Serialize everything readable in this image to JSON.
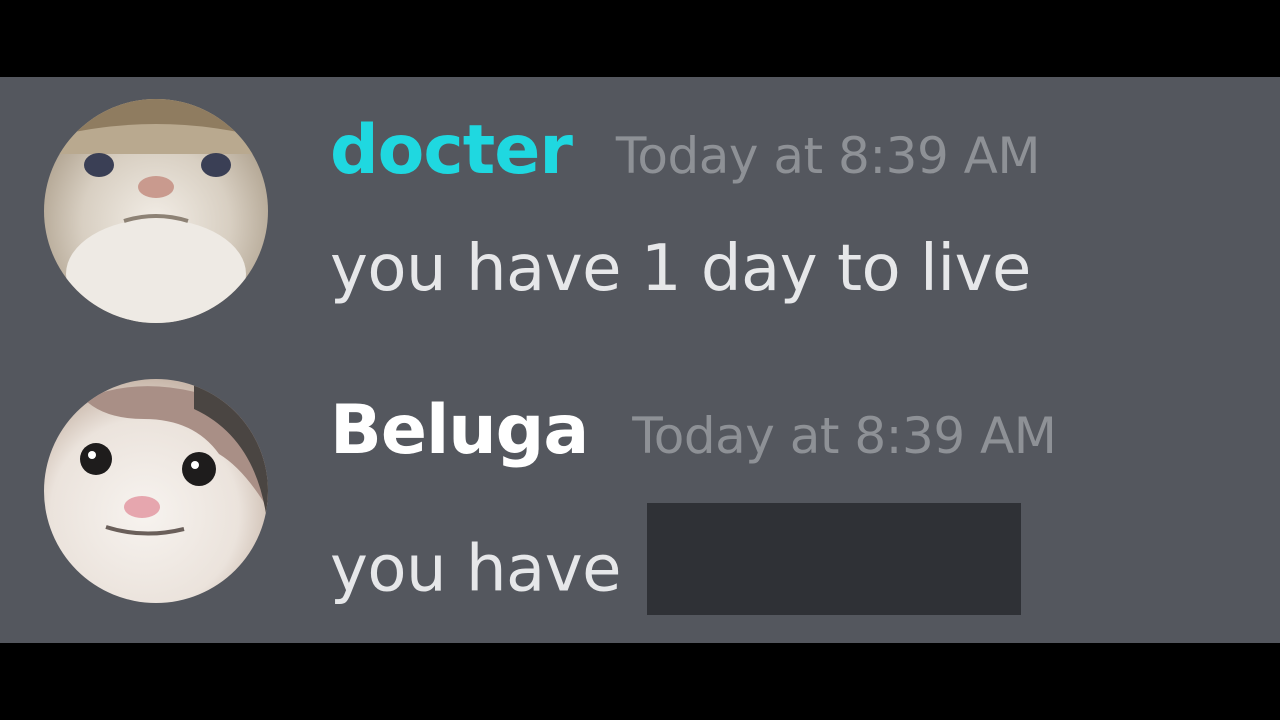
{
  "colors": {
    "chat_background": "#54575e",
    "letterbox": "#000000",
    "timestamp": "#8e9196",
    "message_text": "#e6e7e9",
    "spoiler": "#2f3136"
  },
  "messages": [
    {
      "username": "docter",
      "username_color": "#1fd8e0",
      "timestamp": "Today at 8:39 AM",
      "text": "you have 1 day to live",
      "avatar_icon": "tan-cat-avatar"
    },
    {
      "username": "Beluga",
      "username_color": "#ffffff",
      "timestamp": "Today at 8:39 AM",
      "text": "you have",
      "avatar_icon": "white-cat-avatar",
      "has_spoiler": true
    }
  ]
}
